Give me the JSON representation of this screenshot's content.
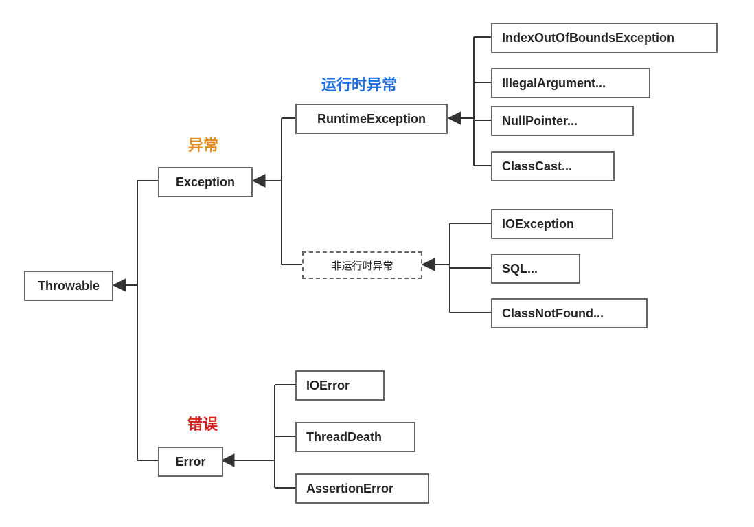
{
  "labels": {
    "runtime": "运行时异常",
    "exception": "异常",
    "error": "错误",
    "nonRuntime": "非运行时异常"
  },
  "nodes": {
    "throwable": "Throwable",
    "exception": "Exception",
    "error": "Error",
    "runtime": "RuntimeException",
    "ioobe": "IndexOutOfBoundsException",
    "illegal": "IllegalArgument...",
    "npe": "NullPointer...",
    "classcast": "ClassCast...",
    "ioexception": "IOException",
    "sql": "SQL...",
    "cnf": "ClassNotFound...",
    "ioerror": "IOError",
    "threaddeath": "ThreadDeath",
    "assertion": "AssertionError"
  },
  "colors": {
    "runtimeLabel": "#1E6FE0",
    "exceptionLabel": "#E08C1E",
    "errorLabel": "#D82020",
    "boxfg": "#222222",
    "border": "#666666",
    "stroke": "#333333"
  }
}
